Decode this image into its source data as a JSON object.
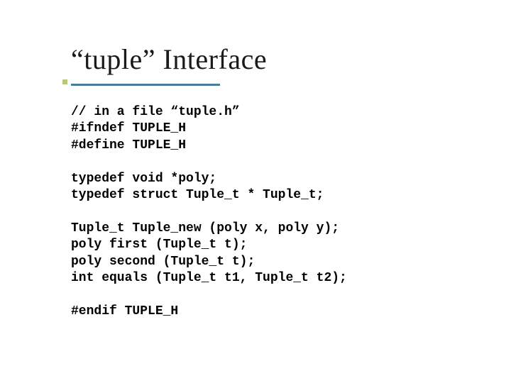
{
  "title": "“tuple” Interface",
  "code": {
    "l1": "// in a file “tuple.h”",
    "l2": "#ifndef TUPLE_H",
    "l3": "#define TUPLE_H",
    "l4": "",
    "l5": "typedef void *poly;",
    "l6": "typedef struct Tuple_t * Tuple_t;",
    "l7": "",
    "l8": "Tuple_t Tuple_new (poly x, poly y);",
    "l9": "poly first (Tuple_t t);",
    "l10": "poly second (Tuple_t t);",
    "l11": "int equals (Tuple_t t1, Tuple_t t2);",
    "l12": "",
    "l13": "#endif TUPLE_H"
  }
}
